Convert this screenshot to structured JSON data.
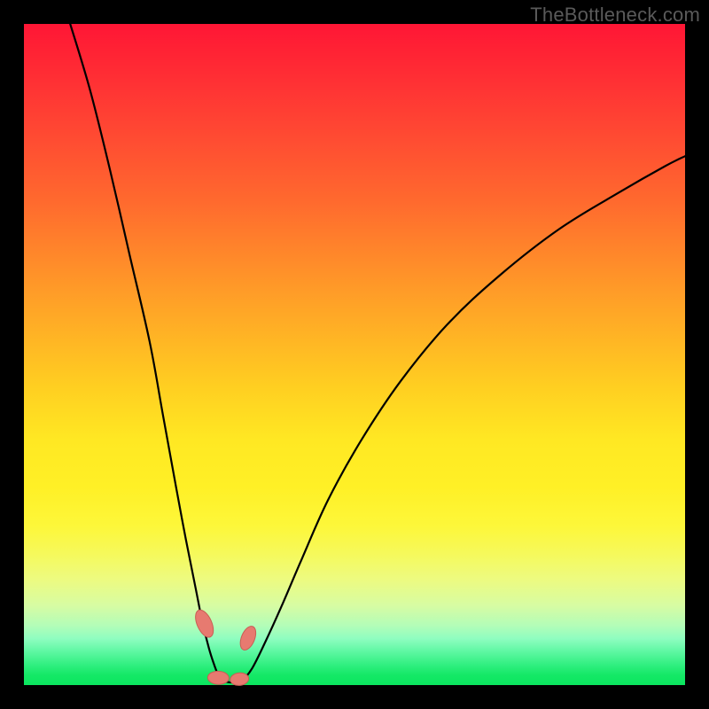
{
  "watermark": "TheBottleneck.com",
  "chart_data": {
    "type": "line",
    "title": "",
    "xlabel": "",
    "ylabel": "",
    "xlim": [
      0,
      100
    ],
    "ylim": [
      0,
      100
    ],
    "grid": false,
    "legend": false,
    "background": "rainbow-gradient",
    "curve_left": {
      "name": "left-branch",
      "x": [
        7,
        10,
        13,
        16,
        19,
        21,
        23,
        24.5,
        26,
        27,
        28,
        28.8,
        29.4,
        30
      ],
      "y": [
        100,
        90,
        78,
        65,
        52,
        41,
        30,
        22,
        14.5,
        9.5,
        5.5,
        3,
        1.5,
        0.6
      ]
    },
    "curve_right": {
      "name": "right-branch",
      "x": [
        33,
        34.5,
        36.5,
        39,
        42,
        46,
        51,
        57,
        64,
        72,
        81,
        90,
        97,
        100
      ],
      "y": [
        0.6,
        2.5,
        6.5,
        12,
        19,
        28,
        37,
        46,
        54.5,
        62,
        69,
        74.5,
        78.5,
        80
      ]
    },
    "curve_floor": {
      "name": "floor",
      "x": [
        30,
        31.5,
        33
      ],
      "y": [
        0.6,
        0.4,
        0.6
      ]
    },
    "markers": [
      {
        "shape": "pill",
        "cx": 27.3,
        "cy": 9.3,
        "rx": 1.1,
        "ry": 2.2,
        "angle": -24
      },
      {
        "shape": "pill",
        "cx": 33.9,
        "cy": 7.1,
        "rx": 1.0,
        "ry": 1.9,
        "angle": 22
      },
      {
        "shape": "pill",
        "cx": 29.4,
        "cy": 1.1,
        "rx": 1.6,
        "ry": 1.0,
        "angle": 2
      },
      {
        "shape": "pill",
        "cx": 32.6,
        "cy": 0.9,
        "rx": 1.4,
        "ry": 0.95,
        "angle": -6
      }
    ]
  }
}
